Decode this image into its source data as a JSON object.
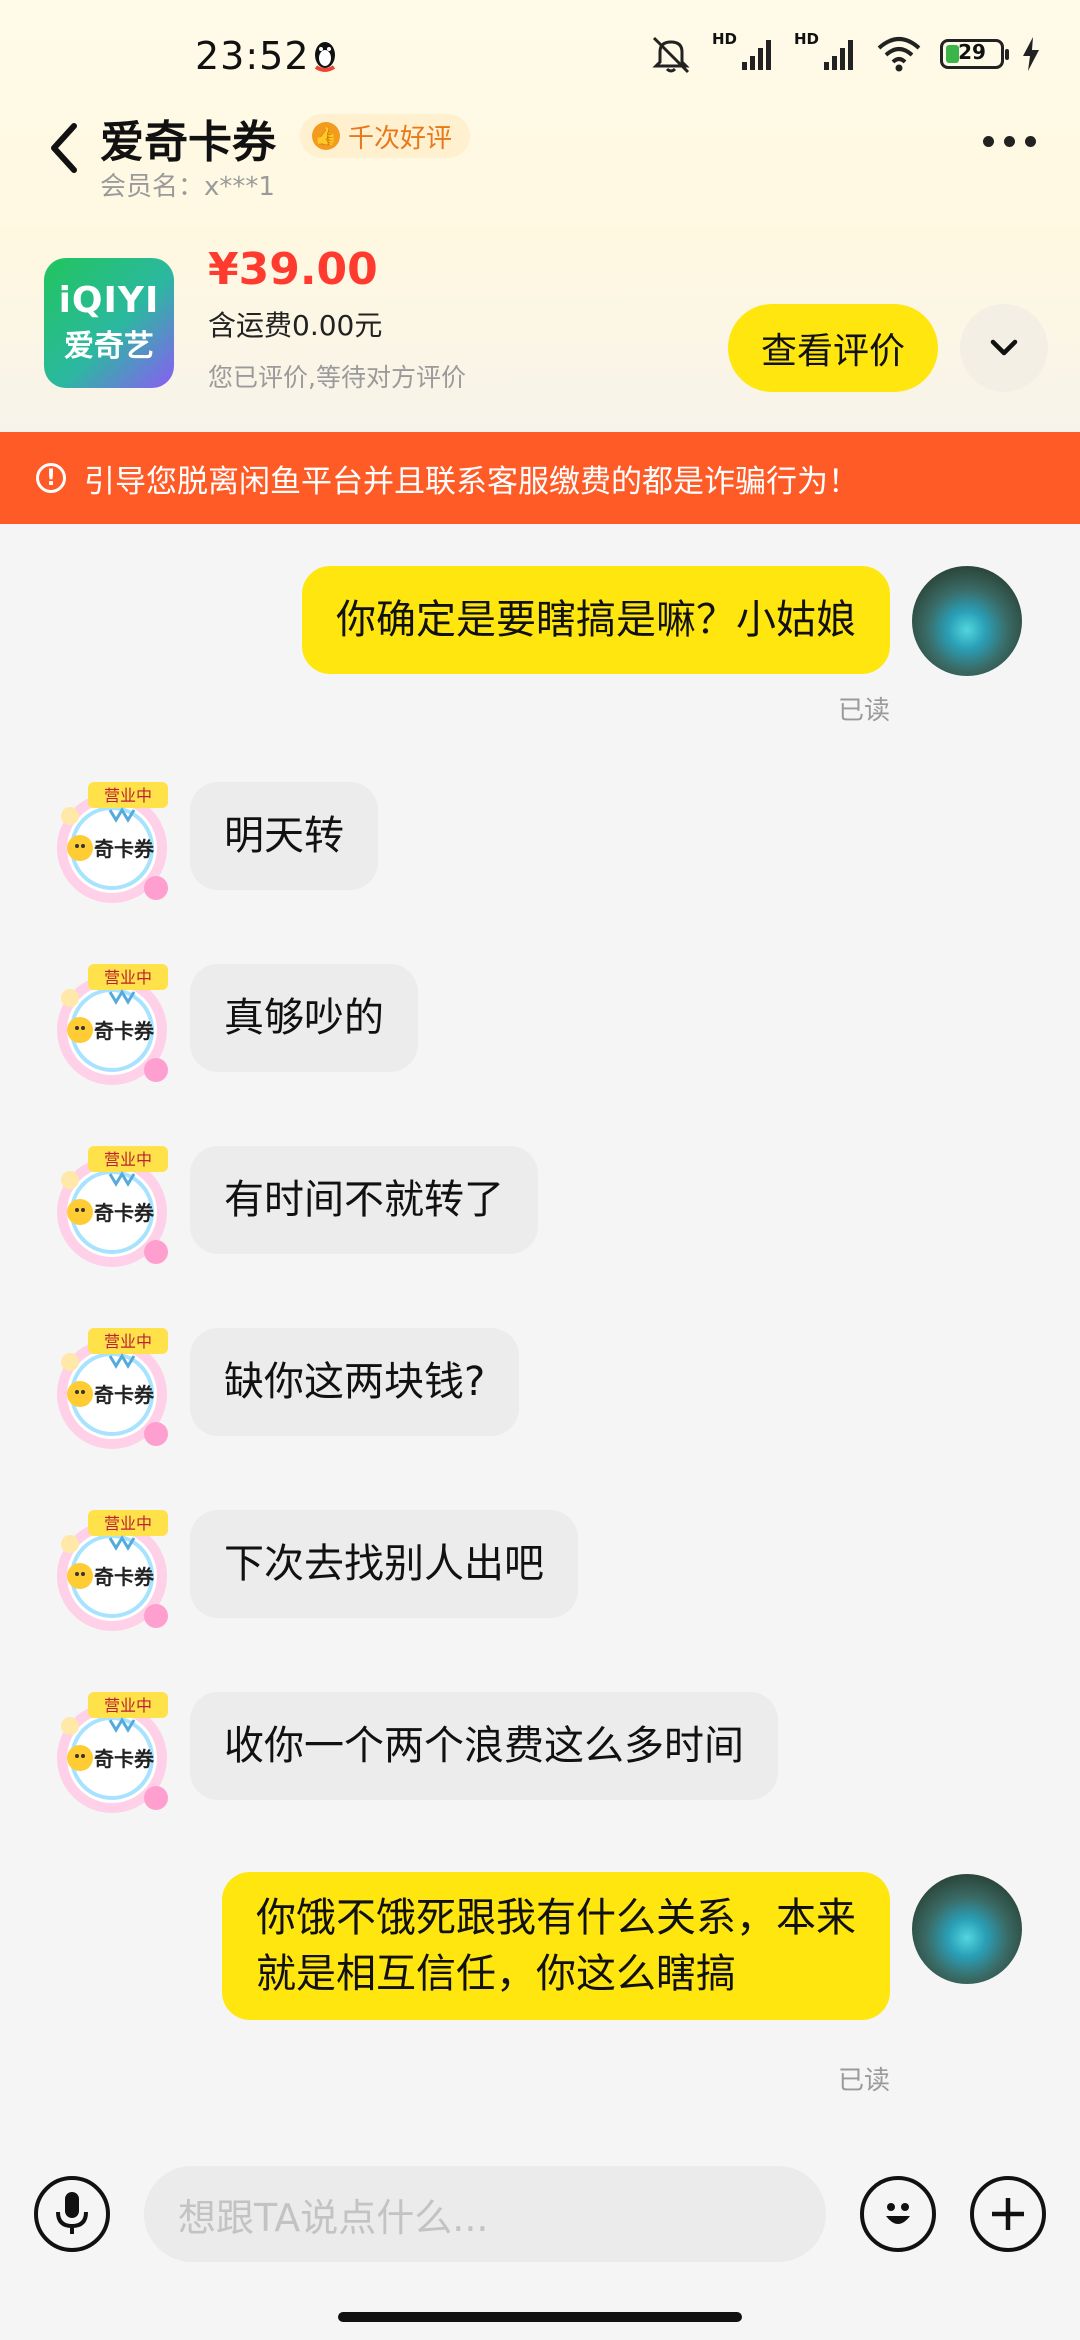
{
  "status": {
    "time": "23:52",
    "hd1": "HD",
    "hd2": "HD",
    "battery": "29"
  },
  "header": {
    "title": "爱奇卡券",
    "badge": "千次好评",
    "member": "会员名：x***1"
  },
  "product": {
    "logo_line1": "iQIYI",
    "logo_line2": "爱奇艺",
    "price": "¥39.00",
    "shipping": "含运费0.00元",
    "rated_status": "您已评价,等待对方评价",
    "review_button": "查看评价"
  },
  "warning": "引导您脱离闲鱼平台并且联系客服缴费的都是诈骗行为！",
  "messages": [
    {
      "from": "me",
      "text": "你确定是要瞎搞是嘛？小姑娘",
      "read": "已读"
    },
    {
      "from": "them",
      "text": "明天转"
    },
    {
      "from": "them",
      "text": "真够吵的"
    },
    {
      "from": "them",
      "text": "有时间不就转了"
    },
    {
      "from": "them",
      "text": "缺你这两块钱?"
    },
    {
      "from": "them",
      "text": "下次去找别人出吧"
    },
    {
      "from": "them",
      "text": "收你一个两个浪费这么多时间"
    },
    {
      "from": "me",
      "text_line1": "你饿不饿死跟我有什么关系，本来",
      "text_line2": "就是相互信任，你这么瞎搞",
      "read": "已读"
    }
  ],
  "shop_avatar": {
    "tag": "营业中",
    "name": "奇卡券"
  },
  "input": {
    "placeholder": "想跟TA说点什么..."
  },
  "colors": {
    "accent_yellow": "#ffe60f",
    "warning_red": "#ff5b27",
    "price_red": "#ff3b30"
  }
}
